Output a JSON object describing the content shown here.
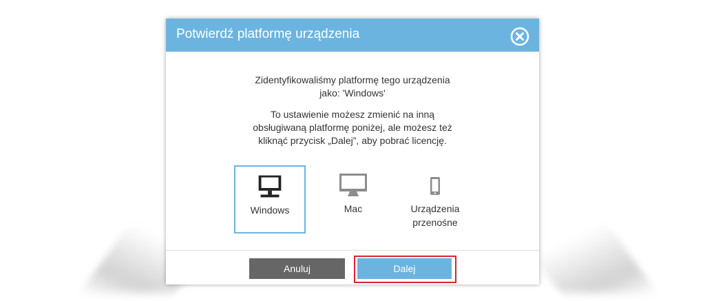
{
  "dialog": {
    "title": "Potwierdź platformę urządzenia",
    "close_icon": "close-circle-icon",
    "message_line1": "Zidentyfikowaliśmy platformę tego urządzenia",
    "message_line2": "jako: 'Windows'",
    "info_line1": "To ustawienie możesz zmienić na inną",
    "info_line2": "obsługiwaną platformę poniżej, ale możesz też",
    "info_line3": "kliknąć przycisk „Dalej”, aby pobrać licencję.",
    "platforms": [
      {
        "label": "Windows",
        "icon": "monitor-icon",
        "selected": true
      },
      {
        "label": "Mac",
        "icon": "monitor-icon",
        "selected": false
      },
      {
        "label_line1": "Urządzenia",
        "label_line2": "przenośne",
        "icon": "phone-icon",
        "selected": false
      }
    ],
    "cancel_label": "Anuluj",
    "next_label": "Dalej"
  },
  "colors": {
    "accent": "#6cb4e0",
    "cancel": "#666666",
    "highlight": "#d9232d"
  }
}
